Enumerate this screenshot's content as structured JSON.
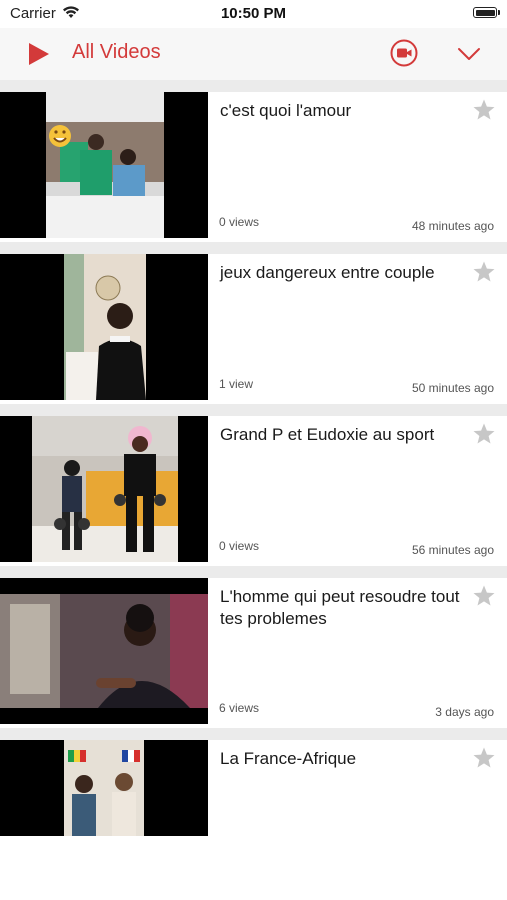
{
  "status_bar": {
    "carrier": "Carrier",
    "time": "10:50 PM"
  },
  "nav": {
    "title": "All Videos",
    "title_color": "#d33a3a",
    "icons": [
      "play-logo-icon",
      "record-video-icon",
      "chevron-down-icon"
    ]
  },
  "videos": [
    {
      "title": "c'est quoi l'amour",
      "views": "0 views",
      "time": "48 minutes ago",
      "thumb_caption": "",
      "thumb_emoji": "🤣"
    },
    {
      "title": "jeux dangereux entre couple",
      "views": "1 view",
      "time": "50 minutes ago"
    },
    {
      "title": "Grand P et Eudoxie au sport",
      "views": "0 views",
      "time": "56 minutes ago"
    },
    {
      "title": "L'homme qui peut resoudre tout tes problemes",
      "views": "6 views",
      "time": "3 days ago"
    },
    {
      "title": "La France-Afrique",
      "views": "",
      "time": ""
    }
  ],
  "colors": {
    "accent": "#d33a3a",
    "star": "#c7c7c7",
    "separator": "#ebebeb"
  }
}
